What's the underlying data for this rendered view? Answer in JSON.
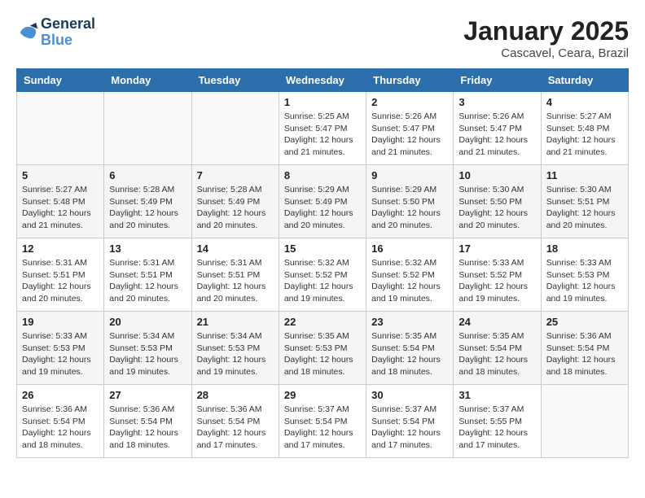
{
  "header": {
    "logo_line1": "General",
    "logo_line2": "Blue",
    "month_title": "January 2025",
    "location": "Cascavel, Ceara, Brazil"
  },
  "days_of_week": [
    "Sunday",
    "Monday",
    "Tuesday",
    "Wednesday",
    "Thursday",
    "Friday",
    "Saturday"
  ],
  "weeks": [
    [
      {
        "day": "",
        "info": ""
      },
      {
        "day": "",
        "info": ""
      },
      {
        "day": "",
        "info": ""
      },
      {
        "day": "1",
        "info": "Sunrise: 5:25 AM\nSunset: 5:47 PM\nDaylight: 12 hours and 21 minutes."
      },
      {
        "day": "2",
        "info": "Sunrise: 5:26 AM\nSunset: 5:47 PM\nDaylight: 12 hours and 21 minutes."
      },
      {
        "day": "3",
        "info": "Sunrise: 5:26 AM\nSunset: 5:47 PM\nDaylight: 12 hours and 21 minutes."
      },
      {
        "day": "4",
        "info": "Sunrise: 5:27 AM\nSunset: 5:48 PM\nDaylight: 12 hours and 21 minutes."
      }
    ],
    [
      {
        "day": "5",
        "info": "Sunrise: 5:27 AM\nSunset: 5:48 PM\nDaylight: 12 hours and 21 minutes."
      },
      {
        "day": "6",
        "info": "Sunrise: 5:28 AM\nSunset: 5:49 PM\nDaylight: 12 hours and 20 minutes."
      },
      {
        "day": "7",
        "info": "Sunrise: 5:28 AM\nSunset: 5:49 PM\nDaylight: 12 hours and 20 minutes."
      },
      {
        "day": "8",
        "info": "Sunrise: 5:29 AM\nSunset: 5:49 PM\nDaylight: 12 hours and 20 minutes."
      },
      {
        "day": "9",
        "info": "Sunrise: 5:29 AM\nSunset: 5:50 PM\nDaylight: 12 hours and 20 minutes."
      },
      {
        "day": "10",
        "info": "Sunrise: 5:30 AM\nSunset: 5:50 PM\nDaylight: 12 hours and 20 minutes."
      },
      {
        "day": "11",
        "info": "Sunrise: 5:30 AM\nSunset: 5:51 PM\nDaylight: 12 hours and 20 minutes."
      }
    ],
    [
      {
        "day": "12",
        "info": "Sunrise: 5:31 AM\nSunset: 5:51 PM\nDaylight: 12 hours and 20 minutes."
      },
      {
        "day": "13",
        "info": "Sunrise: 5:31 AM\nSunset: 5:51 PM\nDaylight: 12 hours and 20 minutes."
      },
      {
        "day": "14",
        "info": "Sunrise: 5:31 AM\nSunset: 5:51 PM\nDaylight: 12 hours and 20 minutes."
      },
      {
        "day": "15",
        "info": "Sunrise: 5:32 AM\nSunset: 5:52 PM\nDaylight: 12 hours and 19 minutes."
      },
      {
        "day": "16",
        "info": "Sunrise: 5:32 AM\nSunset: 5:52 PM\nDaylight: 12 hours and 19 minutes."
      },
      {
        "day": "17",
        "info": "Sunrise: 5:33 AM\nSunset: 5:52 PM\nDaylight: 12 hours and 19 minutes."
      },
      {
        "day": "18",
        "info": "Sunrise: 5:33 AM\nSunset: 5:53 PM\nDaylight: 12 hours and 19 minutes."
      }
    ],
    [
      {
        "day": "19",
        "info": "Sunrise: 5:33 AM\nSunset: 5:53 PM\nDaylight: 12 hours and 19 minutes."
      },
      {
        "day": "20",
        "info": "Sunrise: 5:34 AM\nSunset: 5:53 PM\nDaylight: 12 hours and 19 minutes."
      },
      {
        "day": "21",
        "info": "Sunrise: 5:34 AM\nSunset: 5:53 PM\nDaylight: 12 hours and 19 minutes."
      },
      {
        "day": "22",
        "info": "Sunrise: 5:35 AM\nSunset: 5:53 PM\nDaylight: 12 hours and 18 minutes."
      },
      {
        "day": "23",
        "info": "Sunrise: 5:35 AM\nSunset: 5:54 PM\nDaylight: 12 hours and 18 minutes."
      },
      {
        "day": "24",
        "info": "Sunrise: 5:35 AM\nSunset: 5:54 PM\nDaylight: 12 hours and 18 minutes."
      },
      {
        "day": "25",
        "info": "Sunrise: 5:36 AM\nSunset: 5:54 PM\nDaylight: 12 hours and 18 minutes."
      }
    ],
    [
      {
        "day": "26",
        "info": "Sunrise: 5:36 AM\nSunset: 5:54 PM\nDaylight: 12 hours and 18 minutes."
      },
      {
        "day": "27",
        "info": "Sunrise: 5:36 AM\nSunset: 5:54 PM\nDaylight: 12 hours and 18 minutes."
      },
      {
        "day": "28",
        "info": "Sunrise: 5:36 AM\nSunset: 5:54 PM\nDaylight: 12 hours and 17 minutes."
      },
      {
        "day": "29",
        "info": "Sunrise: 5:37 AM\nSunset: 5:54 PM\nDaylight: 12 hours and 17 minutes."
      },
      {
        "day": "30",
        "info": "Sunrise: 5:37 AM\nSunset: 5:54 PM\nDaylight: 12 hours and 17 minutes."
      },
      {
        "day": "31",
        "info": "Sunrise: 5:37 AM\nSunset: 5:55 PM\nDaylight: 12 hours and 17 minutes."
      },
      {
        "day": "",
        "info": ""
      }
    ]
  ]
}
